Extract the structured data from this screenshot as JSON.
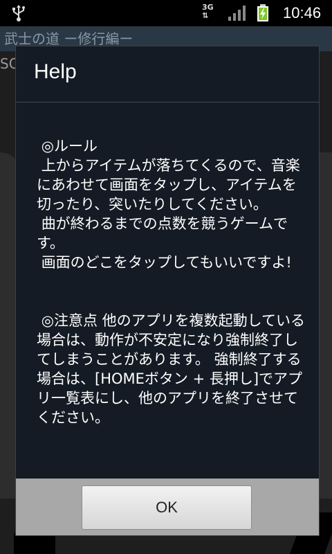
{
  "status_bar": {
    "network": "3G",
    "time": "10:46",
    "icons": [
      "usb-icon",
      "network-3g-icon",
      "signal-icon",
      "battery-charging-icon"
    ]
  },
  "background_app": {
    "title": "武士の道 ー修行編ー",
    "score_label": "SC"
  },
  "dialog": {
    "title": "Help",
    "content": " ◎ルール\n 上からアイテムが落ちてくるので、音楽にあわせて画面をタップし、アイテムを切ったり、突いたりしてください。\n 曲が終わるまでの点数を競うゲームです。\n 画面のどこをタップしてもいいですよ!\n\n\n ◎注意点 他のアプリを複数起動している場合は、動作が不安定になり強制終了してしまうことがあります。 強制終了する場合は、[HOMEボタン + 長押し]でアプリ一覧表にし、他のアプリを終了させてください。",
    "ok_label": "OK"
  },
  "colors": {
    "dialog_bg": "#141b24",
    "title_bar_bg": "#2a3846",
    "button_bar_bg": "#a8a8a8"
  }
}
